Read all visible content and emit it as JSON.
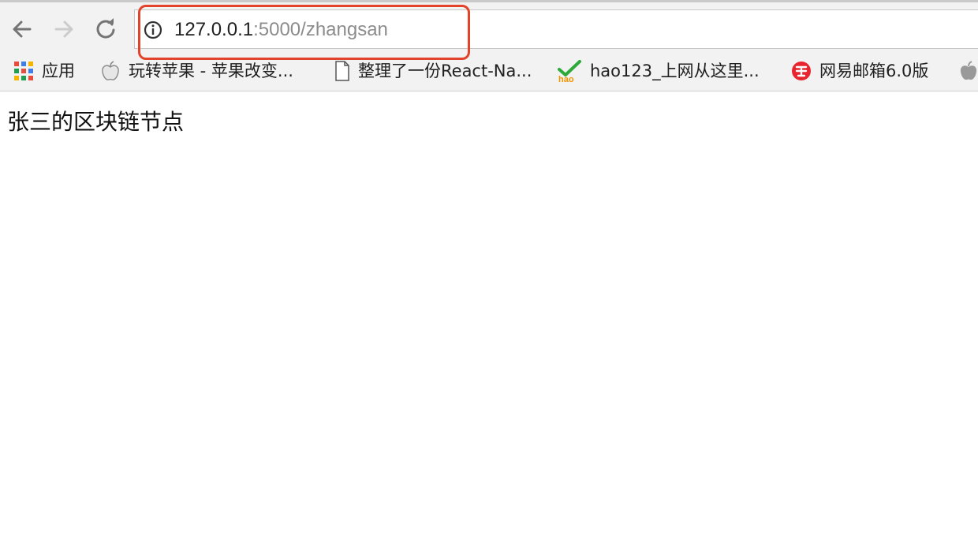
{
  "toolbar": {
    "back_icon": "arrow-left-icon",
    "forward_icon": "arrow-right-icon",
    "reload_icon": "reload-icon"
  },
  "address_bar": {
    "info_icon": "info-icon",
    "url_host": "127.0.0.1",
    "url_rest": ":5000/zhangsan",
    "highlight_color": "#e3432b"
  },
  "bookmarks": {
    "apps_label": "应用",
    "items": [
      {
        "label": "玩转苹果 - 苹果改变...",
        "icon": "apple-site-icon"
      },
      {
        "label": "整理了一份React-Na...",
        "icon": "document-icon"
      },
      {
        "label": "hao123_上网从这里...",
        "icon": "hao123-icon"
      },
      {
        "label": "网易邮箱6.0版",
        "icon": "netease-mail-icon"
      }
    ],
    "overflow_icon": "apple-logo-icon"
  },
  "page": {
    "body_text": "张三的区块链节点"
  }
}
